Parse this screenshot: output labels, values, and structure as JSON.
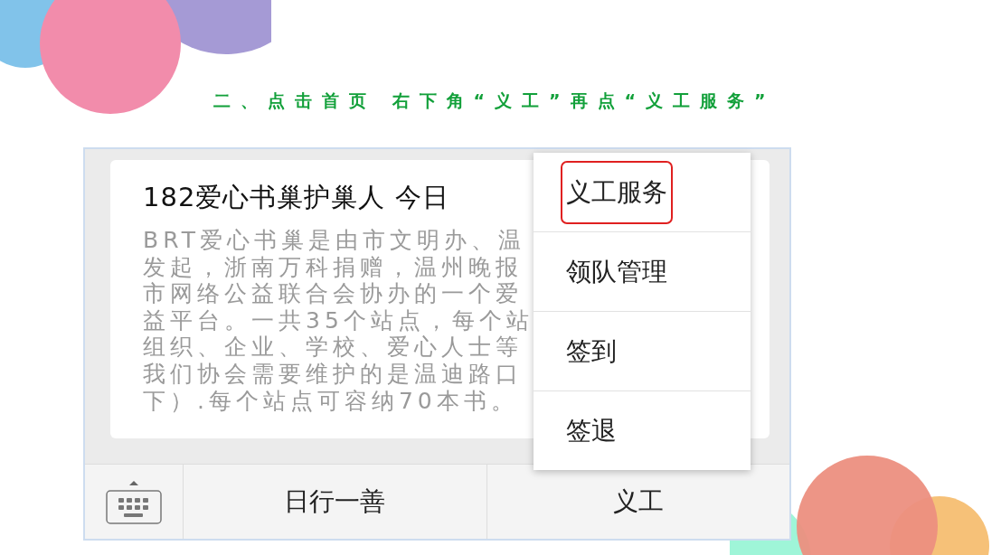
{
  "heading": "二、点击首页 右下角“义工”再点“义工服务”",
  "card": {
    "title": "182爱心书巢护巢人 今日",
    "lines": [
      "BRT爱心书巢是由市文明办、温",
      "发起，浙南万科捐赠，温州晚报",
      "市网络公益联合会协办的一个爱",
      "益平台。一共35个站点，每个站",
      "组织、企业、学校、爱心人士等",
      "我们协会需要维护的是温迪路口",
      "下）.每个站点可容纳70本书。"
    ]
  },
  "menu": {
    "items": [
      {
        "label": "义工服务",
        "highlighted": true
      },
      {
        "label": "领队管理",
        "highlighted": false
      },
      {
        "label": "签到",
        "highlighted": false
      },
      {
        "label": "签退",
        "highlighted": false
      }
    ]
  },
  "bottom_bar": {
    "tabs": [
      "日行一善",
      "义工"
    ]
  }
}
